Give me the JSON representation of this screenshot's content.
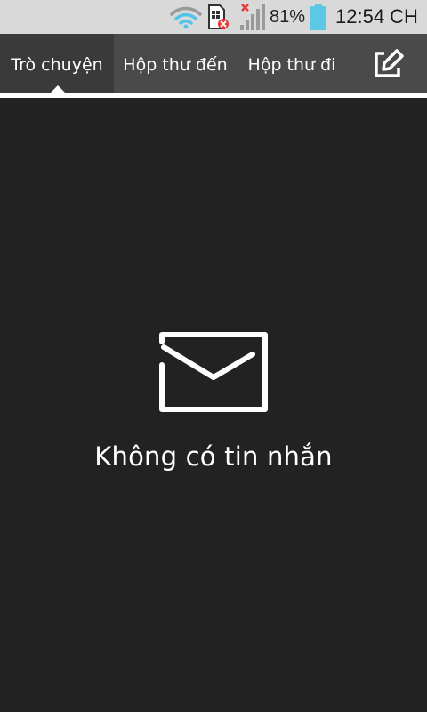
{
  "status_bar": {
    "wifi_icon": "wifi-icon",
    "sim_icon": "sim-error-icon",
    "signal_icon": "no-signal-icon",
    "battery_percent": "81%",
    "battery_level": 0.81,
    "time": "12:54 CH",
    "colors": {
      "wifi": "#4fc3e8",
      "battery": "#5cc8e6",
      "error": "#e53935"
    }
  },
  "tabs": [
    {
      "label": "Trò chuyện",
      "active": true
    },
    {
      "label": "Hộp thư đến",
      "active": false
    },
    {
      "label": "Hộp thư đi",
      "active": false
    }
  ],
  "compose_icon": "compose-icon",
  "empty_state": {
    "icon": "envelope-icon",
    "message": "Không có tin nhắn"
  }
}
